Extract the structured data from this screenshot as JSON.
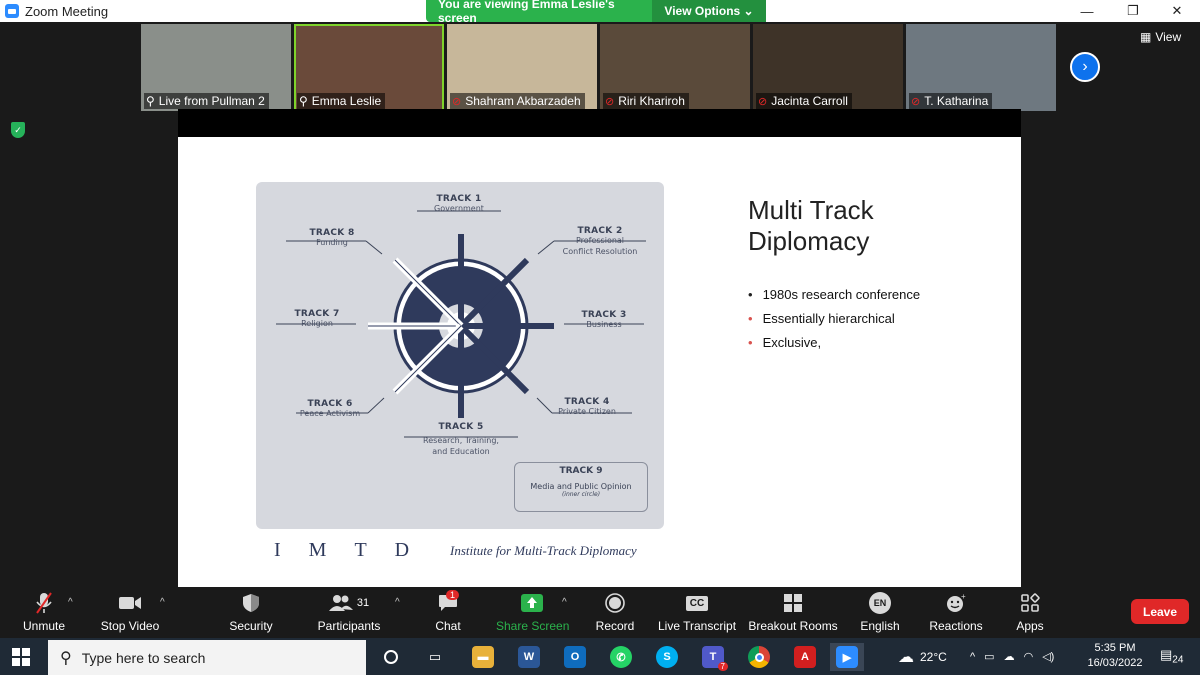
{
  "window": {
    "title": "Zoom Meeting",
    "minimize": "—",
    "restore": "❐",
    "close": "✕"
  },
  "banner": {
    "message": "You are viewing Emma Leslie's screen",
    "view_options": "View Options ⌄"
  },
  "participants": [
    {
      "name": "Live from Pullman 2",
      "muted": false,
      "bg": "#8a8f8a"
    },
    {
      "name": "Emma Leslie",
      "muted": false,
      "bg": "#6a4a3a",
      "speaking": true
    },
    {
      "name": "Shahram Akbarzadeh",
      "muted": true,
      "bg": "#c7b79a"
    },
    {
      "name": "Riri Khariroh",
      "muted": true,
      "bg": "#5a4a3a"
    },
    {
      "name": "Jacinta Carroll",
      "muted": true,
      "bg": "#3e3328"
    },
    {
      "name": "T. Katharina",
      "muted": true,
      "bg": "#6e7880"
    }
  ],
  "view_label": "View",
  "slide": {
    "title_line1": "Multi Track",
    "title_line2": "Diplomacy",
    "bullets": [
      {
        "text": "1980s research conference",
        "color": "#222222"
      },
      {
        "text": "Essentially hierarchical",
        "color": "#d9534f"
      },
      {
        "text": "Exclusive,",
        "color": "#d9534f"
      }
    ],
    "diagram": {
      "track1": {
        "title": "TRACK 1",
        "desc": "Government"
      },
      "track2": {
        "title": "TRACK 2",
        "desc1": "Professional",
        "desc2": "Conflict Resolution"
      },
      "track3": {
        "title": "TRACK 3",
        "desc": "Business"
      },
      "track4": {
        "title": "TRACK 4",
        "desc": "Private Citizen"
      },
      "track5": {
        "title": "TRACK 5",
        "desc1": "Research, Training,",
        "desc2": "and Education"
      },
      "track6": {
        "title": "TRACK 6",
        "desc": "Peace Activism"
      },
      "track7": {
        "title": "TRACK 7",
        "desc": "Religion"
      },
      "track8": {
        "title": "TRACK 8",
        "desc": "Funding"
      },
      "track9": {
        "title": "TRACK 9",
        "desc": "Media and Public Opinion",
        "note": "(inner circle)"
      }
    },
    "logo_letters": "IMTD",
    "logo_text": "Institute for Multi-Track Diplomacy"
  },
  "toolbar": {
    "unmute": "Unmute",
    "stop_video": "Stop Video",
    "security": "Security",
    "participants": "Participants",
    "participants_count": "31",
    "chat": "Chat",
    "chat_badge": "1",
    "share_screen": "Share Screen",
    "record": "Record",
    "live_transcript": "Live Transcript",
    "cc": "CC",
    "breakout_rooms": "Breakout Rooms",
    "language_code": "EN",
    "english": "English",
    "reactions": "Reactions",
    "apps": "Apps",
    "leave": "Leave"
  },
  "taskbar": {
    "search_placeholder": "Type here to search",
    "temperature": "22°C",
    "time": "5:35 PM",
    "date": "16/03/2022",
    "notification_count": "24",
    "teams_badge": "7"
  }
}
